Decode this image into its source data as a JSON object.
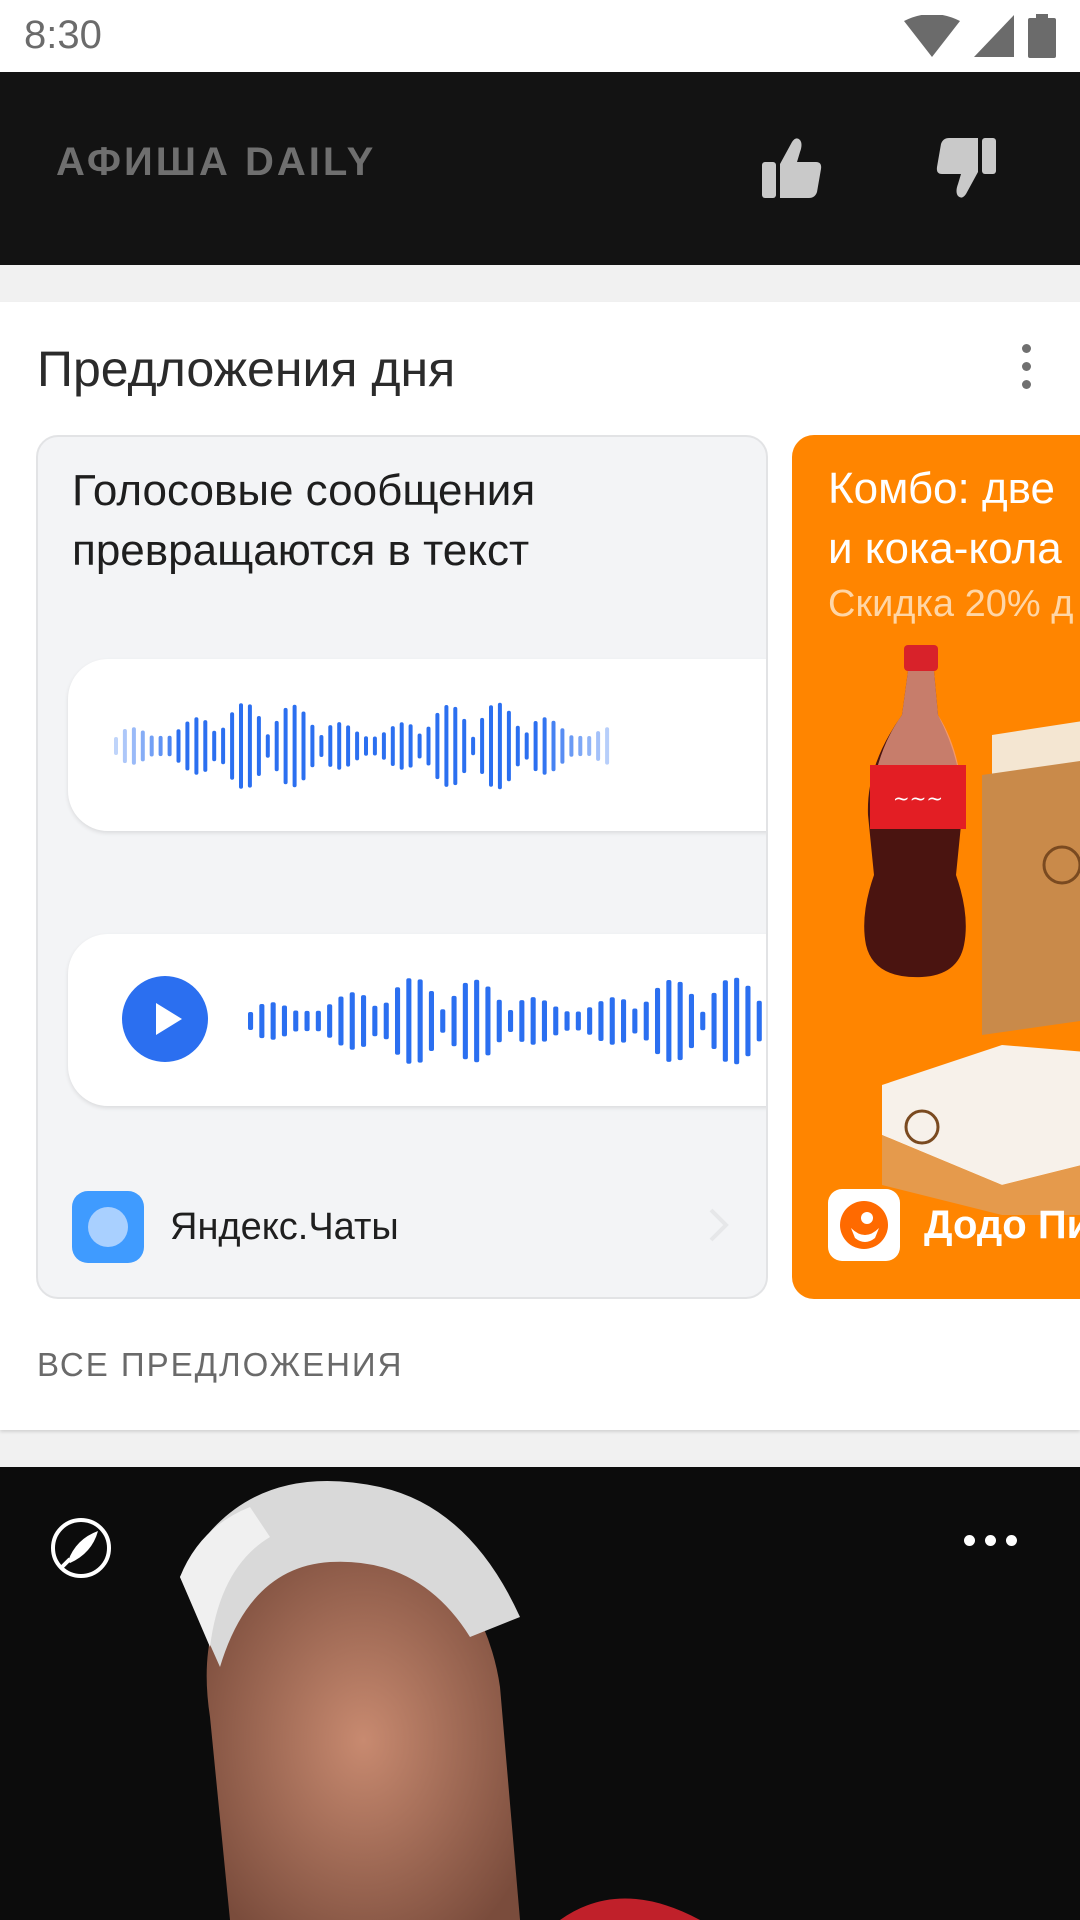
{
  "status_bar": {
    "time": "8:30",
    "icons": [
      "wifi-icon",
      "cell-signal-icon",
      "battery-icon"
    ]
  },
  "header": {
    "brand": "АФИША DAILY",
    "like_icon": "thumbs-up-icon",
    "dislike_icon": "thumbs-down-icon"
  },
  "offers": {
    "title": "Предложения дня",
    "menu_icon": "vertical-dots-icon",
    "cards": [
      {
        "title_line1": "Голосовые сообщения",
        "title_line2": "превращаются в текст",
        "app_name": "Яндекс.Чаты",
        "background": "#f3f4f6"
      },
      {
        "title_line1": "Комбо: две",
        "title_line2": "и кока-кола",
        "subtitle": "Скидка 20% д",
        "app_name": "Додо Пи",
        "background": "#ff8500"
      }
    ],
    "all_link": "ВСЕ ПРЕДЛОЖЕНИЯ"
  },
  "news": {
    "source_icon": "rocket-icon",
    "more_icon": "horizontal-dots-icon"
  },
  "colors": {
    "accent_blue": "#2b6ff0",
    "dodo_orange": "#ff8500",
    "header_bg": "#131313"
  }
}
